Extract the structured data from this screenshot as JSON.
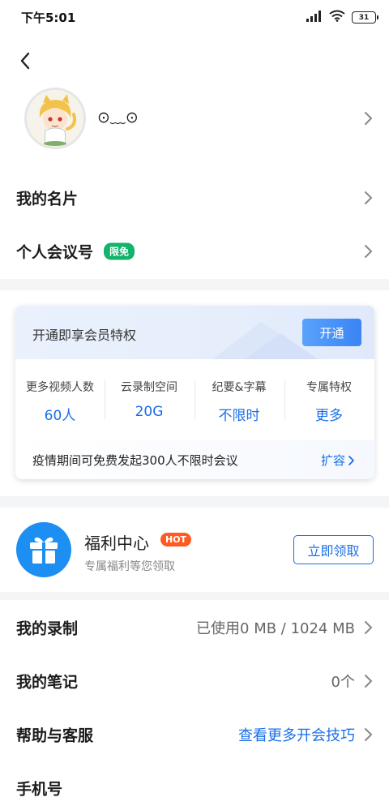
{
  "status_bar": {
    "time": "下午5:01",
    "battery": "31",
    "icons": [
      "signal-icon",
      "wifi-icon",
      "battery-icon"
    ]
  },
  "profile": {
    "nickname": "⊙﹏⊙"
  },
  "menu": {
    "my_card": "我的名片",
    "personal_meeting_id": "个人会议号",
    "free_badge": "限免"
  },
  "vip": {
    "title": "开通即享会员特权",
    "open_button": "开通",
    "perks": [
      {
        "name": "更多视频人数",
        "value": "60人"
      },
      {
        "name": "云录制空间",
        "value": "20G"
      },
      {
        "name": "纪要&字幕",
        "value": "不限时"
      },
      {
        "name": "专属特权",
        "value": "更多"
      }
    ],
    "note": "疫情期间可免费发起300人不限时会议",
    "expand_link": "扩容"
  },
  "welfare": {
    "title": "福利中心",
    "hot_badge": "HOT",
    "subtitle": "专属福利等您领取",
    "claim_button": "立即领取"
  },
  "settings": {
    "recording_label": "我的录制",
    "recording_value": "已使用0 MB / 1024 MB",
    "notes_label": "我的笔记",
    "notes_value": "0个",
    "help_label": "帮助与客服",
    "help_value": "查看更多开会技巧",
    "phone_label": "手机号"
  },
  "colors": {
    "accent": "#1a6fe8",
    "free_badge": "#12b36a",
    "hot_badge": "#ff5a1f",
    "gift_circle": "#1d8ef2"
  }
}
